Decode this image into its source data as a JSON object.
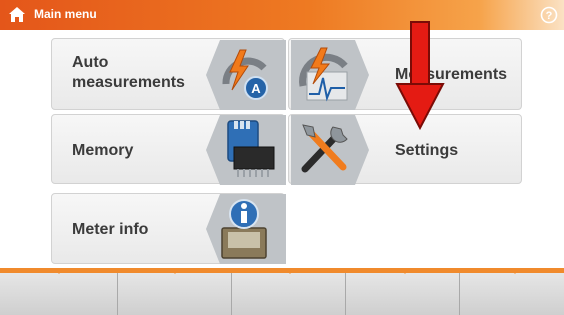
{
  "header": {
    "title": "Main menu",
    "home_icon": "home-icon",
    "help_icon": "help-icon",
    "bar_color": "#e4561a"
  },
  "menu": {
    "auto_measurements": "Auto\nmeasurements",
    "measurements": "Measurements",
    "memory": "Memory",
    "settings": "Settings",
    "meter_info": "Meter info"
  },
  "icons": {
    "auto": "auto-measurement-icon",
    "measurements": "measurement-gauge-icon",
    "memory": "memory-card-icon",
    "settings": "tools-icon",
    "meter_info": "meter-info-icon"
  },
  "footer": {
    "buttons": [
      "",
      "",
      "",
      "",
      ""
    ],
    "accent_color": "#f08a2c"
  },
  "annotation": {
    "arrow_color": "#e41b13"
  }
}
